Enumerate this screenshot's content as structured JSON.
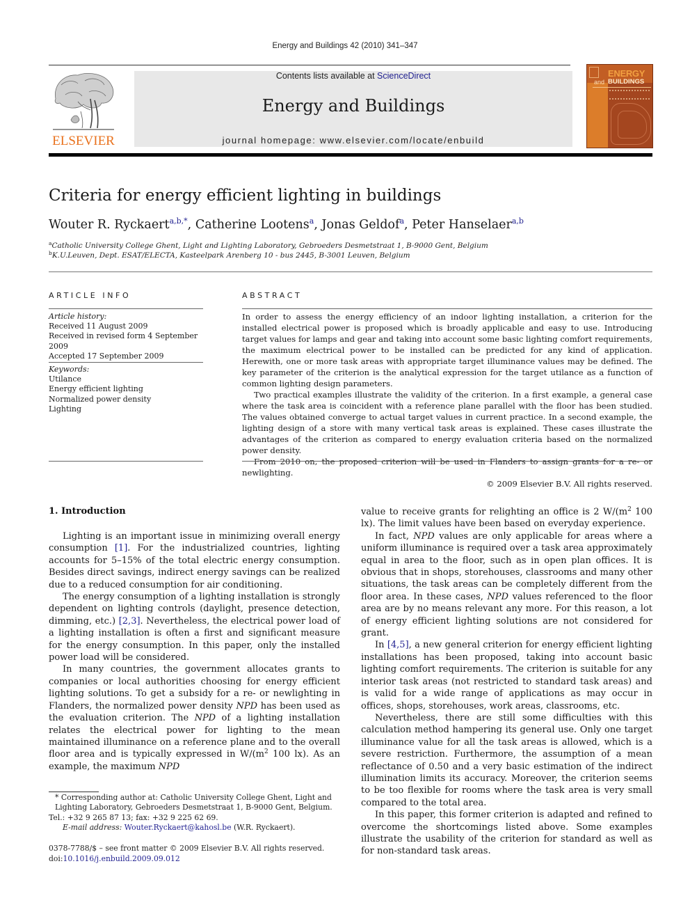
{
  "header": {
    "journal_reference": "Energy and Buildings 42 (2010) 341–347",
    "contents_prefix": "Contents lists available at ",
    "contents_link": "ScienceDirect",
    "journal_title": "Energy and Buildings",
    "homepage": "journal homepage: www.elsevier.com/locate/enbuild",
    "publisher_logo_text": "ELSEVIER",
    "cover": {
      "energy": "ENERGY",
      "and": "and",
      "buildings": "BUILDINGS"
    },
    "colors": {
      "elsevier_orange": "#e9711c",
      "link_blue": "#1f1f8f",
      "cover_brown": "#a4461f"
    }
  },
  "article": {
    "title": "Criteria for energy efficient lighting in buildings",
    "authors": [
      {
        "name": "Wouter R. Ryckaert",
        "sup": "a,b,*",
        "sep": ", "
      },
      {
        "name": "Catherine Lootens",
        "sup": "a",
        "sep": ", "
      },
      {
        "name": "Jonas Geldof",
        "sup": "a",
        "sep": ", "
      },
      {
        "name": "Peter Hanselaer",
        "sup": "a,b",
        "sep": ""
      }
    ],
    "affiliations": [
      {
        "mark": "a",
        "text": "Catholic University College Ghent, Light and Lighting Laboratory, Gebroeders Desmetstraat 1, B-9000 Gent, Belgium"
      },
      {
        "mark": "b",
        "text": "K.U.Leuven, Dept. ESAT/ELECTA, Kasteelpark Arenberg 10 - bus 2445, B-3001 Leuven, Belgium"
      }
    ]
  },
  "article_info": {
    "label": "ARTICLE INFO",
    "history_label": "Article history:",
    "history": [
      "Received 11 August 2009",
      "Received in revised form 4 September 2009",
      "Accepted 17 September 2009"
    ],
    "keywords_label": "Keywords:",
    "keywords": [
      "Utilance",
      "Energy efficient lighting",
      "Normalized power density",
      "Lighting"
    ]
  },
  "abstract": {
    "label": "ABSTRACT",
    "paragraphs": [
      "In order to assess the energy efficiency of an indoor lighting installation, a criterion for the installed electrical power is proposed which is broadly applicable and easy to use. Introducing target values for lamps and gear and taking into account some basic lighting comfort requirements, the maximum electrical power to be installed can be predicted for any kind of application. Herewith, one or more task areas with appropriate target illuminance values may be defined. The key parameter of the criterion is the analytical expression for the target utilance as a function of common lighting design parameters.",
      "Two practical examples illustrate the validity of the criterion. In a first example, a general case where the task area is coincident with a reference plane parallel with the floor has been studied. The values obtained converge to actual target values in current practice. In a second example, the lighting design of a store with many vertical task areas is explained. These cases illustrate the advantages of the criterion as compared to energy evaluation criteria based on the normalized power density.",
      "From 2010 on, the proposed criterion will be used in Flanders to assign grants for a re- or newlighting."
    ],
    "copyright": "© 2009 Elsevier B.V. All rights reserved."
  },
  "body": {
    "section_heading": "1.  Introduction",
    "left": {
      "p1_a": "Lighting is an important issue in minimizing overall energy consumption ",
      "p1_ref": "[1]",
      "p1_b": ". For the industrialized countries, lighting accounts for 5–15% of the total electric energy consumption. Besides direct savings, indirect energy savings can be realized due to a reduced consumption for air conditioning.",
      "p2_a": "The energy consumption of a lighting installation is strongly dependent on lighting controls (daylight, presence detection, dimming, etc.) ",
      "p2_ref": "[2,3]",
      "p2_b": ". Nevertheless, the electrical power load of a lighting installation is often a first and significant measure for the energy consumption. In this paper, only the installed power load will be considered.",
      "p3_a": "In many countries, the government allocates grants to companies or local authorities choosing for energy efficient lighting solutions. To get a subsidy for a re- or newlighting in Flanders, the normalized power density ",
      "p3_npd1": "NPD",
      "p3_b": " has been used as the evaluation criterion. The ",
      "p3_npd2": "NPD",
      "p3_c": " of a lighting installation relates the electrical power for lighting to the mean maintained illuminance on a reference plane and to the overall floor area and is typically expressed in W/(m",
      "p3_sup": "2",
      "p3_d": " 100 lx). As an example, the maximum ",
      "p3_npd3": "NPD"
    },
    "right": {
      "p1_a": "value to receive grants for relighting an office is 2 W/(m",
      "p1_sup": "2",
      "p1_b": " 100 lx). The limit values have been based on everyday experience.",
      "p2_a": "In fact, ",
      "p2_npd1": "NPD",
      "p2_b": " values are only applicable for areas where a uniform illuminance is required over a task area approximately equal in area to the floor, such as in open plan offices. It is obvious that in shops, storehouses, classrooms and many other situations, the task areas can be completely different from the floor area. In these cases, ",
      "p2_npd2": "NPD",
      "p2_c": " values referenced to the floor area are by no means relevant any more. For this reason, a lot of energy efficient lighting solutions are not considered for grant.",
      "p3_a": "In ",
      "p3_ref": "[4,5]",
      "p3_b": ", a new general criterion for energy efficient lighting installations has been proposed, taking into account basic lighting comfort requirements. The criterion is suitable for any interior task areas (not restricted to standard task areas) and is valid for a wide range of applications as may occur in offices, shops, storehouses, work areas, classrooms, etc.",
      "p4": "Nevertheless, there are still some difficulties with this calculation method hampering its general use. Only one target illuminance value for all the task areas is allowed, which is a severe restriction. Furthermore, the assumption of a mean reflectance of 0.50 and a very basic estimation of the indirect illumination limits its accuracy. Moreover, the criterion seems to be too flexible for rooms where the task area is very small compared to the total area.",
      "p5": "In this paper, this former criterion is adapted and refined to overcome the shortcomings listed above. Some examples illustrate the usability of the criterion for standard as well as for non-standard task areas."
    }
  },
  "footnote": {
    "corresponding": "* Corresponding author at: Catholic University College Ghent, Light and Lighting Laboratory, Gebroeders Desmetstraat 1, B-9000 Gent, Belgium.",
    "phone": "Tel.: +32 9 265 87 13; fax: +32 9 225 62 69.",
    "email_label": "E-mail address: ",
    "email": "Wouter.Ryckaert@kahosl.be",
    "email_suffix": " (W.R. Ryckaert)."
  },
  "front_matter": {
    "issn_line": "0378-7788/$ – see front matter © 2009 Elsevier B.V. All rights reserved.",
    "doi_prefix": "doi:",
    "doi": "10.1016/j.enbuild.2009.09.012"
  }
}
